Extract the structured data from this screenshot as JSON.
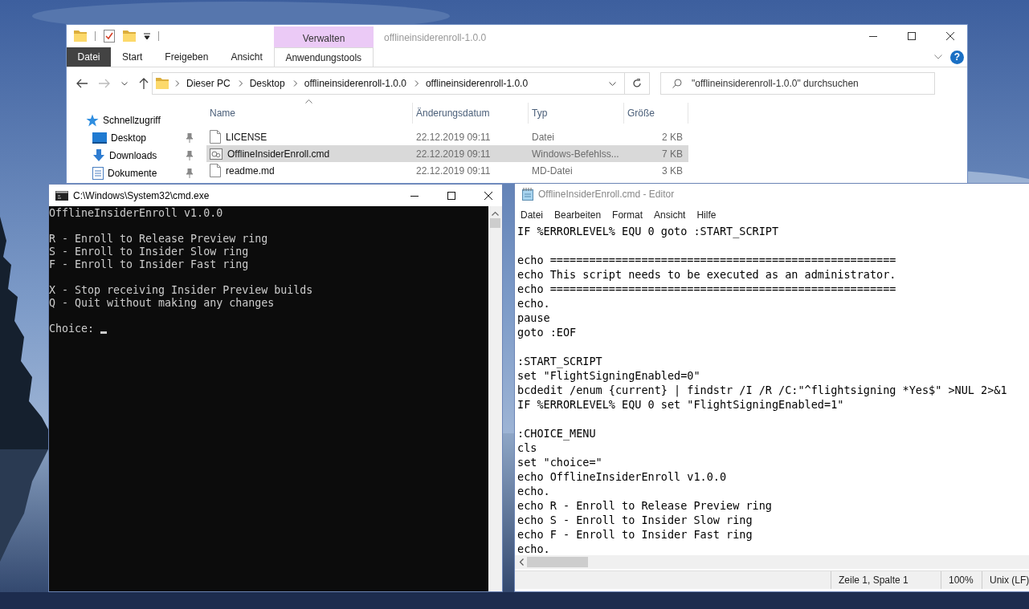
{
  "explorer": {
    "title": "offlineinsiderenroll-1.0.0",
    "context_group": "Verwalten",
    "tabs": [
      {
        "label": "Datei",
        "kind": "file"
      },
      {
        "label": "Start",
        "kind": "normal"
      },
      {
        "label": "Freigeben",
        "kind": "normal"
      },
      {
        "label": "Ansicht",
        "kind": "normal"
      },
      {
        "label": "Anwendungstools",
        "kind": "contextual"
      }
    ],
    "help": "?",
    "breadcrumb": [
      "Dieser PC",
      "Desktop",
      "offlineinsiderenroll-1.0.0",
      "offlineinsiderenroll-1.0.0"
    ],
    "search": {
      "placeholder": "\"offlineinsiderenroll-1.0.0\" durchsuchen"
    },
    "nav_items": [
      {
        "label": "Schnellzugriff",
        "kind": "quick",
        "pinned": false
      },
      {
        "label": "Desktop",
        "kind": "desktop",
        "pinned": true
      },
      {
        "label": "Downloads",
        "kind": "downloads",
        "pinned": true
      },
      {
        "label": "Dokumente",
        "kind": "documents",
        "pinned": true
      }
    ],
    "columns": [
      "Name",
      "Änderungsdatum",
      "Typ",
      "Größe"
    ],
    "rows": [
      {
        "name": "LICENSE",
        "kind": "file",
        "date": "22.12.2019 09:11",
        "type": "Datei",
        "size": "2 KB",
        "selected": false
      },
      {
        "name": "OfflineInsiderEnroll.cmd",
        "kind": "script",
        "date": "22.12.2019 09:11",
        "type": "Windows-Befehlss...",
        "size": "7 KB",
        "selected": true
      },
      {
        "name": "readme.md",
        "kind": "file",
        "date": "22.12.2019 09:11",
        "type": "MD-Datei",
        "size": "3 KB",
        "selected": false
      }
    ]
  },
  "console": {
    "title": "C:\\Windows\\System32\\cmd.exe",
    "blocks": [
      [
        "OfflineInsiderEnroll v1.0.0"
      ],
      [
        "R - Enroll to Release Preview ring",
        "S - Enroll to Insider Slow ring",
        "F - Enroll to Insider Fast ring"
      ],
      [
        "X - Stop receiving Insider Preview builds",
        "Q - Quit without making any changes"
      ],
      [
        "Choice:"
      ]
    ],
    "cursor": true
  },
  "editor": {
    "title": "OfflineInsiderEnroll.cmd - Editor",
    "menu": [
      "Datei",
      "Bearbeiten",
      "Format",
      "Ansicht",
      "Hilfe"
    ],
    "blocks": [
      [
        "IF %ERRORLEVEL% EQU 0 goto :START_SCRIPT"
      ],
      [
        "echo =====================================================",
        "echo This script needs to be executed as an administrator.",
        "echo =====================================================",
        "echo.",
        "pause",
        "goto :EOF"
      ],
      [
        ":START_SCRIPT",
        "set \"FlightSigningEnabled=0\"",
        "bcdedit /enum {current} | findstr /I /R /C:\"^flightsigning *Yes$\" >NUL 2>&1",
        "IF %ERRORLEVEL% EQU 0 set \"FlightSigningEnabled=1\""
      ],
      [
        ":CHOICE_MENU",
        "cls",
        "set \"choice=\"",
        "echo OfflineInsiderEnroll v1.0.0",
        "echo.",
        "echo R - Enroll to Release Preview ring",
        "echo S - Enroll to Insider Slow ring",
        "echo F - Enroll to Insider Fast ring",
        "echo."
      ]
    ],
    "status": {
      "position": "Zeile 1, Spalte 1",
      "zoom": "100%",
      "line_endings": "Unix (LF)"
    }
  }
}
